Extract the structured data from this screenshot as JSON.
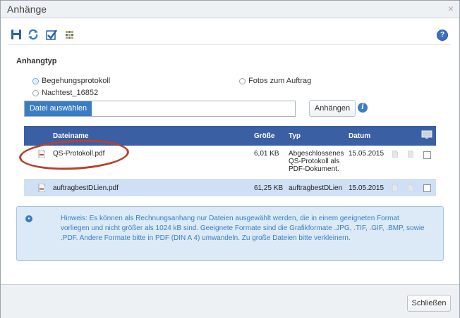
{
  "window": {
    "title": "Anhänge",
    "close_glyph": "×"
  },
  "toolbar": {
    "icons": [
      "save-icon",
      "refresh-icon",
      "checklist-icon",
      "grid-icon"
    ],
    "help_glyph": "?"
  },
  "attachment_type": {
    "label": "Anhangtyp",
    "options": [
      {
        "label": "Begehungsprotokoll",
        "selected": true
      },
      {
        "label": "Fotos zum Auftrag",
        "selected": false
      },
      {
        "label": "Nachtest_16852",
        "selected": false
      }
    ]
  },
  "upload": {
    "choose_label": "Datei auswählen",
    "file_value": "",
    "attach_label": "Anhängen",
    "info_glyph": "i"
  },
  "table": {
    "columns": [
      "Dateiname",
      "Größe",
      "Typ",
      "Datum"
    ],
    "rows": [
      {
        "name": "QS-Protokoll.pdf",
        "size": "6,01 KB",
        "type_lines": [
          "Abgeschlossenes",
          "QS-Protokoll als",
          "PDF-Dokument."
        ],
        "date": "15.05.2015"
      },
      {
        "name": "auftragbestDLien.pdf",
        "size": "61,25 KB",
        "type_lines": [
          "auftragbestDLien"
        ],
        "date": "15.05.2015"
      }
    ]
  },
  "hint": {
    "glyph": "•",
    "text": "Hinweis: Es können als Rechnungsanhang nur Dateien ausgewählt werden, die in einem geeigneten Format vorliegen und nicht größer als 1024 kB sind. Geeignete Formate sind die Grafikformate .JPG, .TIF, .GIF, .BMP, sowie .PDF. Andere Formate bitte in PDF (DIN A 4) umwandeln. Zu große Dateien bitte verkleinern."
  },
  "footer": {
    "close_label": "Schließen"
  },
  "colors": {
    "accent": "#3b7dc4",
    "header_bg": "#3a5fa3",
    "selected_row": "#cfe0f5",
    "highlight_oval": "#b8402c"
  }
}
